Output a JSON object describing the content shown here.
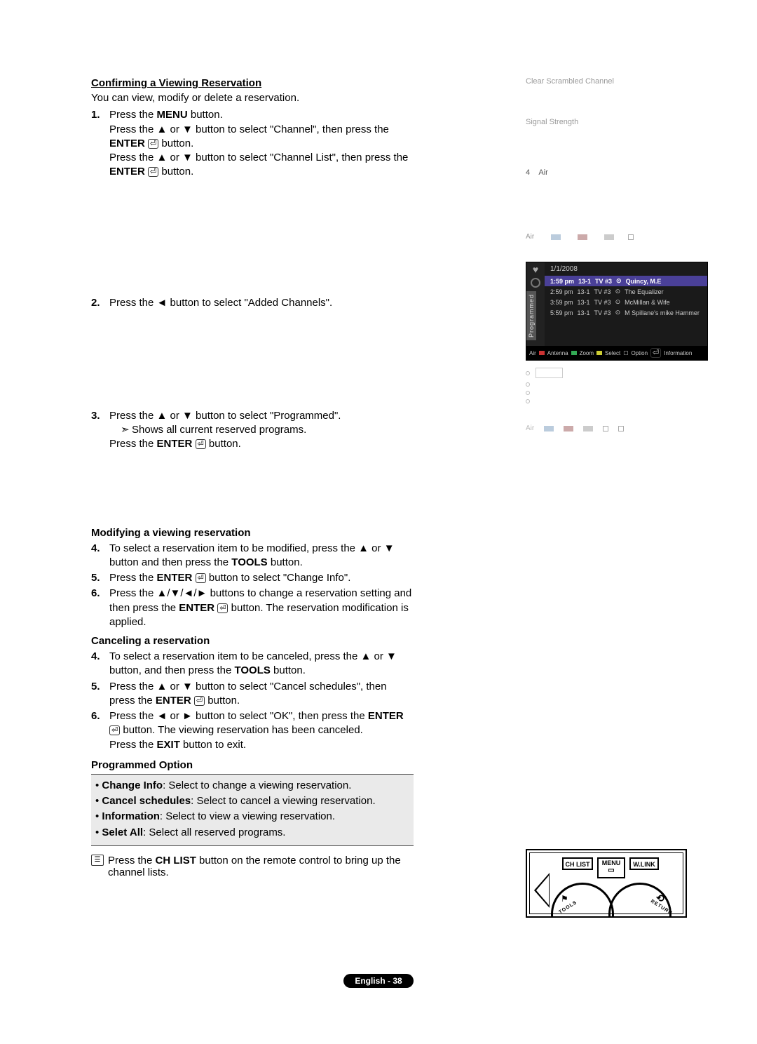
{
  "title": "Confirming a Viewing Reservation",
  "intro": "You can view, modify or delete a reservation.",
  "step1_num": "1.",
  "step1_l1a": "Press the ",
  "step1_l1b": "MENU",
  "step1_l1c": " button.",
  "step1_l2a": "Press the ▲ or ▼ button to select \"Channel\", then press the ",
  "step1_l2b": "ENTER",
  "step1_l2c": " button.",
  "step1_l3a": "Press the ▲ or ▼ button to select \"Channel List\", then press the ",
  "step1_l3b": "ENTER",
  "step1_l3c": " button.",
  "step2_num": "2.",
  "step2_txt": "Press the ◄ button to select \"Added Channels\".",
  "step3_num": "3.",
  "step3_l1": "Press the ▲ or ▼ button to select \"Programmed\".",
  "step3_sub": "Shows all current reserved programs.",
  "step3_l2a": "Press the ",
  "step3_l2b": "ENTER",
  "step3_l2c": " button.",
  "mod_title": "Modifying a viewing reservation",
  "step4_num": "4.",
  "step4_a": "To select a reservation item to be modified, press the ▲ or ▼ button and then press the ",
  "step4_b": "TOOLS",
  "step4_c": " button.",
  "step5_num": "5.",
  "step5_a": "Press the ",
  "step5_b": "ENTER",
  "step5_c": " button to select \"Change Info\".",
  "step6_num": "6.",
  "step6_a": "Press the ▲/▼/◄/► buttons to change a reservation setting and then press the ",
  "step6_b": "ENTER",
  "step6_c": " button. The reservation modification is applied.",
  "can_title": "Canceling a reservation",
  "c4_num": "4.",
  "c4_a": "To select a reservation item to be canceled, press the ▲ or ▼ button, and then press the ",
  "c4_b": "TOOLS",
  "c4_c": " button.",
  "c5_num": "5.",
  "c5_a": "Press the ▲ or ▼ button to select \"Cancel schedules\", then press the ",
  "c5_b": "ENTER",
  "c5_c": " button.",
  "c6_num": "6.",
  "c6_a": "Press the ◄ or ► button to select \"OK\", then press the ",
  "c6_b": "ENTER",
  "c6_c": " button. The viewing reservation has been canceled.",
  "c_exit_a": "Press the ",
  "c_exit_b": "EXIT",
  "c_exit_c": " button to exit.",
  "po_title": "Programmed Option",
  "po": {
    "a": {
      "t": "Change Info",
      "d": ": Select to change a viewing reservation."
    },
    "b": {
      "t": "Cancel schedules",
      "d": ": Select to cancel a viewing reservation."
    },
    "c": {
      "t": "Information",
      "d": ": Select to view a viewing reservation."
    },
    "d": {
      "t": "Selet All",
      "d": ": Select all reserved programs."
    }
  },
  "note_a": "Press the ",
  "note_b": "CH LIST",
  "note_c": " button on the remote control to bring up the channel lists.",
  "right": {
    "csc": "Clear Scrambled Channel",
    "ss": "Signal Strength",
    "ch_num": "4",
    "ch_ant": "Air",
    "leg_air": "Air",
    "dark": {
      "tab": "Programmed",
      "date": "1/1/2008",
      "rows": [
        {
          "t": "1:59 pm",
          "c": "13-1",
          "ch": "TV #3",
          "p": "Quincy, M.E"
        },
        {
          "t": "2:59 pm",
          "c": "13-1",
          "ch": "TV #3",
          "p": "The Equalizer"
        },
        {
          "t": "3:59 pm",
          "c": "13-1",
          "ch": "TV #3",
          "p": "McMillan & Wife"
        },
        {
          "t": "5:59 pm",
          "c": "13-1",
          "ch": "TV #3",
          "p": "M Spillane's mike Hammer"
        }
      ],
      "foot": {
        "air": "Air",
        "ant": "Antenna",
        "zoom": "Zoom",
        "sel": "Select",
        "opt": "Option",
        "info": "Information"
      }
    },
    "tools_leg_air": "Air"
  },
  "remote": {
    "chlist": "CH LIST",
    "menu": "MENU",
    "wlink": "W.LINK",
    "tools": "TOOLS",
    "return": "RETURN"
  },
  "footer": "English - 38",
  "sym": {
    "enter": "⏎",
    "clock": "⊙",
    "note": "☰"
  }
}
